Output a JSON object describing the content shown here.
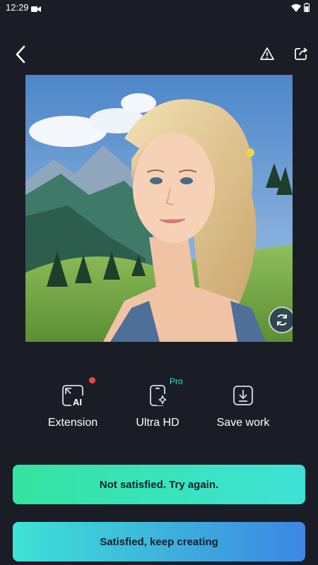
{
  "status": {
    "time": "12:29"
  },
  "icons": {
    "back": "back-arrow-icon",
    "report": "warning-icon",
    "share": "share-icon",
    "regenerate": "refresh-icon"
  },
  "tools": [
    {
      "label": "Extension",
      "icon": "ai-expand-icon",
      "badge": "red-dot"
    },
    {
      "label": "Ultra HD",
      "icon": "phone-sparkle-icon",
      "badge": "Pro"
    },
    {
      "label": "Save work",
      "icon": "download-icon"
    }
  ],
  "buttons": {
    "retry": "Not satisfied. Try again.",
    "keep": "Satisfied, keep creating"
  },
  "colors": {
    "background": "#1b1d26",
    "accent_green": "#34e5a0",
    "accent_teal": "#3ee2d6",
    "accent_blue": "#3d86e3",
    "badge_red": "#ff3b4e"
  }
}
